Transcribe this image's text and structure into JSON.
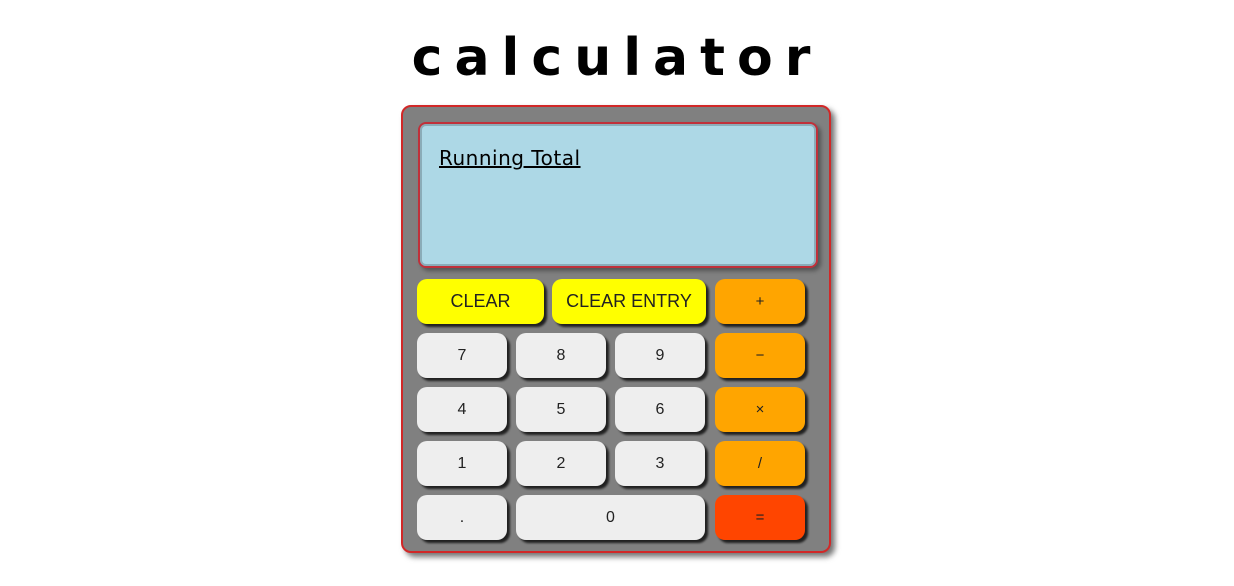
{
  "page": {
    "title": "calculator"
  },
  "calculator": {
    "display": {
      "label": "Running Total",
      "value": ""
    },
    "buttons": {
      "clear": "CLEAR",
      "clear_entry": "CLEAR ENTRY",
      "plus": "+",
      "minus": "−",
      "times": "×",
      "divide": "/",
      "equals": "=",
      "seven": "7",
      "eight": "8",
      "nine": "9",
      "four": "4",
      "five": "5",
      "six": "6",
      "one": "1",
      "two": "2",
      "three": "3",
      "decimal": ".",
      "zero": "0"
    },
    "colors": {
      "body": "#808080",
      "border": "#d12828",
      "display": "#add8e6",
      "clear_buttons": "#ffff00",
      "operator_buttons": "#ffa500",
      "equals_button": "#ff4500",
      "number_buttons": "#eeeeee"
    }
  }
}
